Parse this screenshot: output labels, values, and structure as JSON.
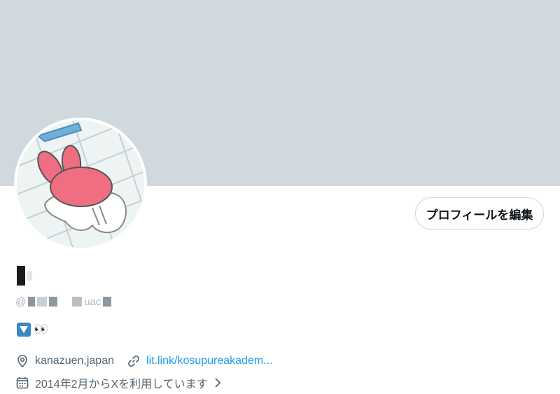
{
  "profile": {
    "edit_button_label": "プロフィールを編集",
    "handle_prefix": "@",
    "handle_visible_part": "uac",
    "bio_emoji": "👀",
    "location": "kanazuen,japan",
    "website": "lit.link/kosupureakadem...",
    "joined": "2014年2月からXを利用しています"
  },
  "colors": {
    "banner": "#cfd9de",
    "link": "#1d9bf0",
    "secondary_text": "#536471",
    "bio_badge": "#3b88c3"
  },
  "icons": {
    "location": "location-pin-icon",
    "website": "link-icon",
    "joined": "calendar-icon",
    "joined_more": "chevron-right-icon",
    "bio_badge": "blue-down-triangle-emoji"
  }
}
